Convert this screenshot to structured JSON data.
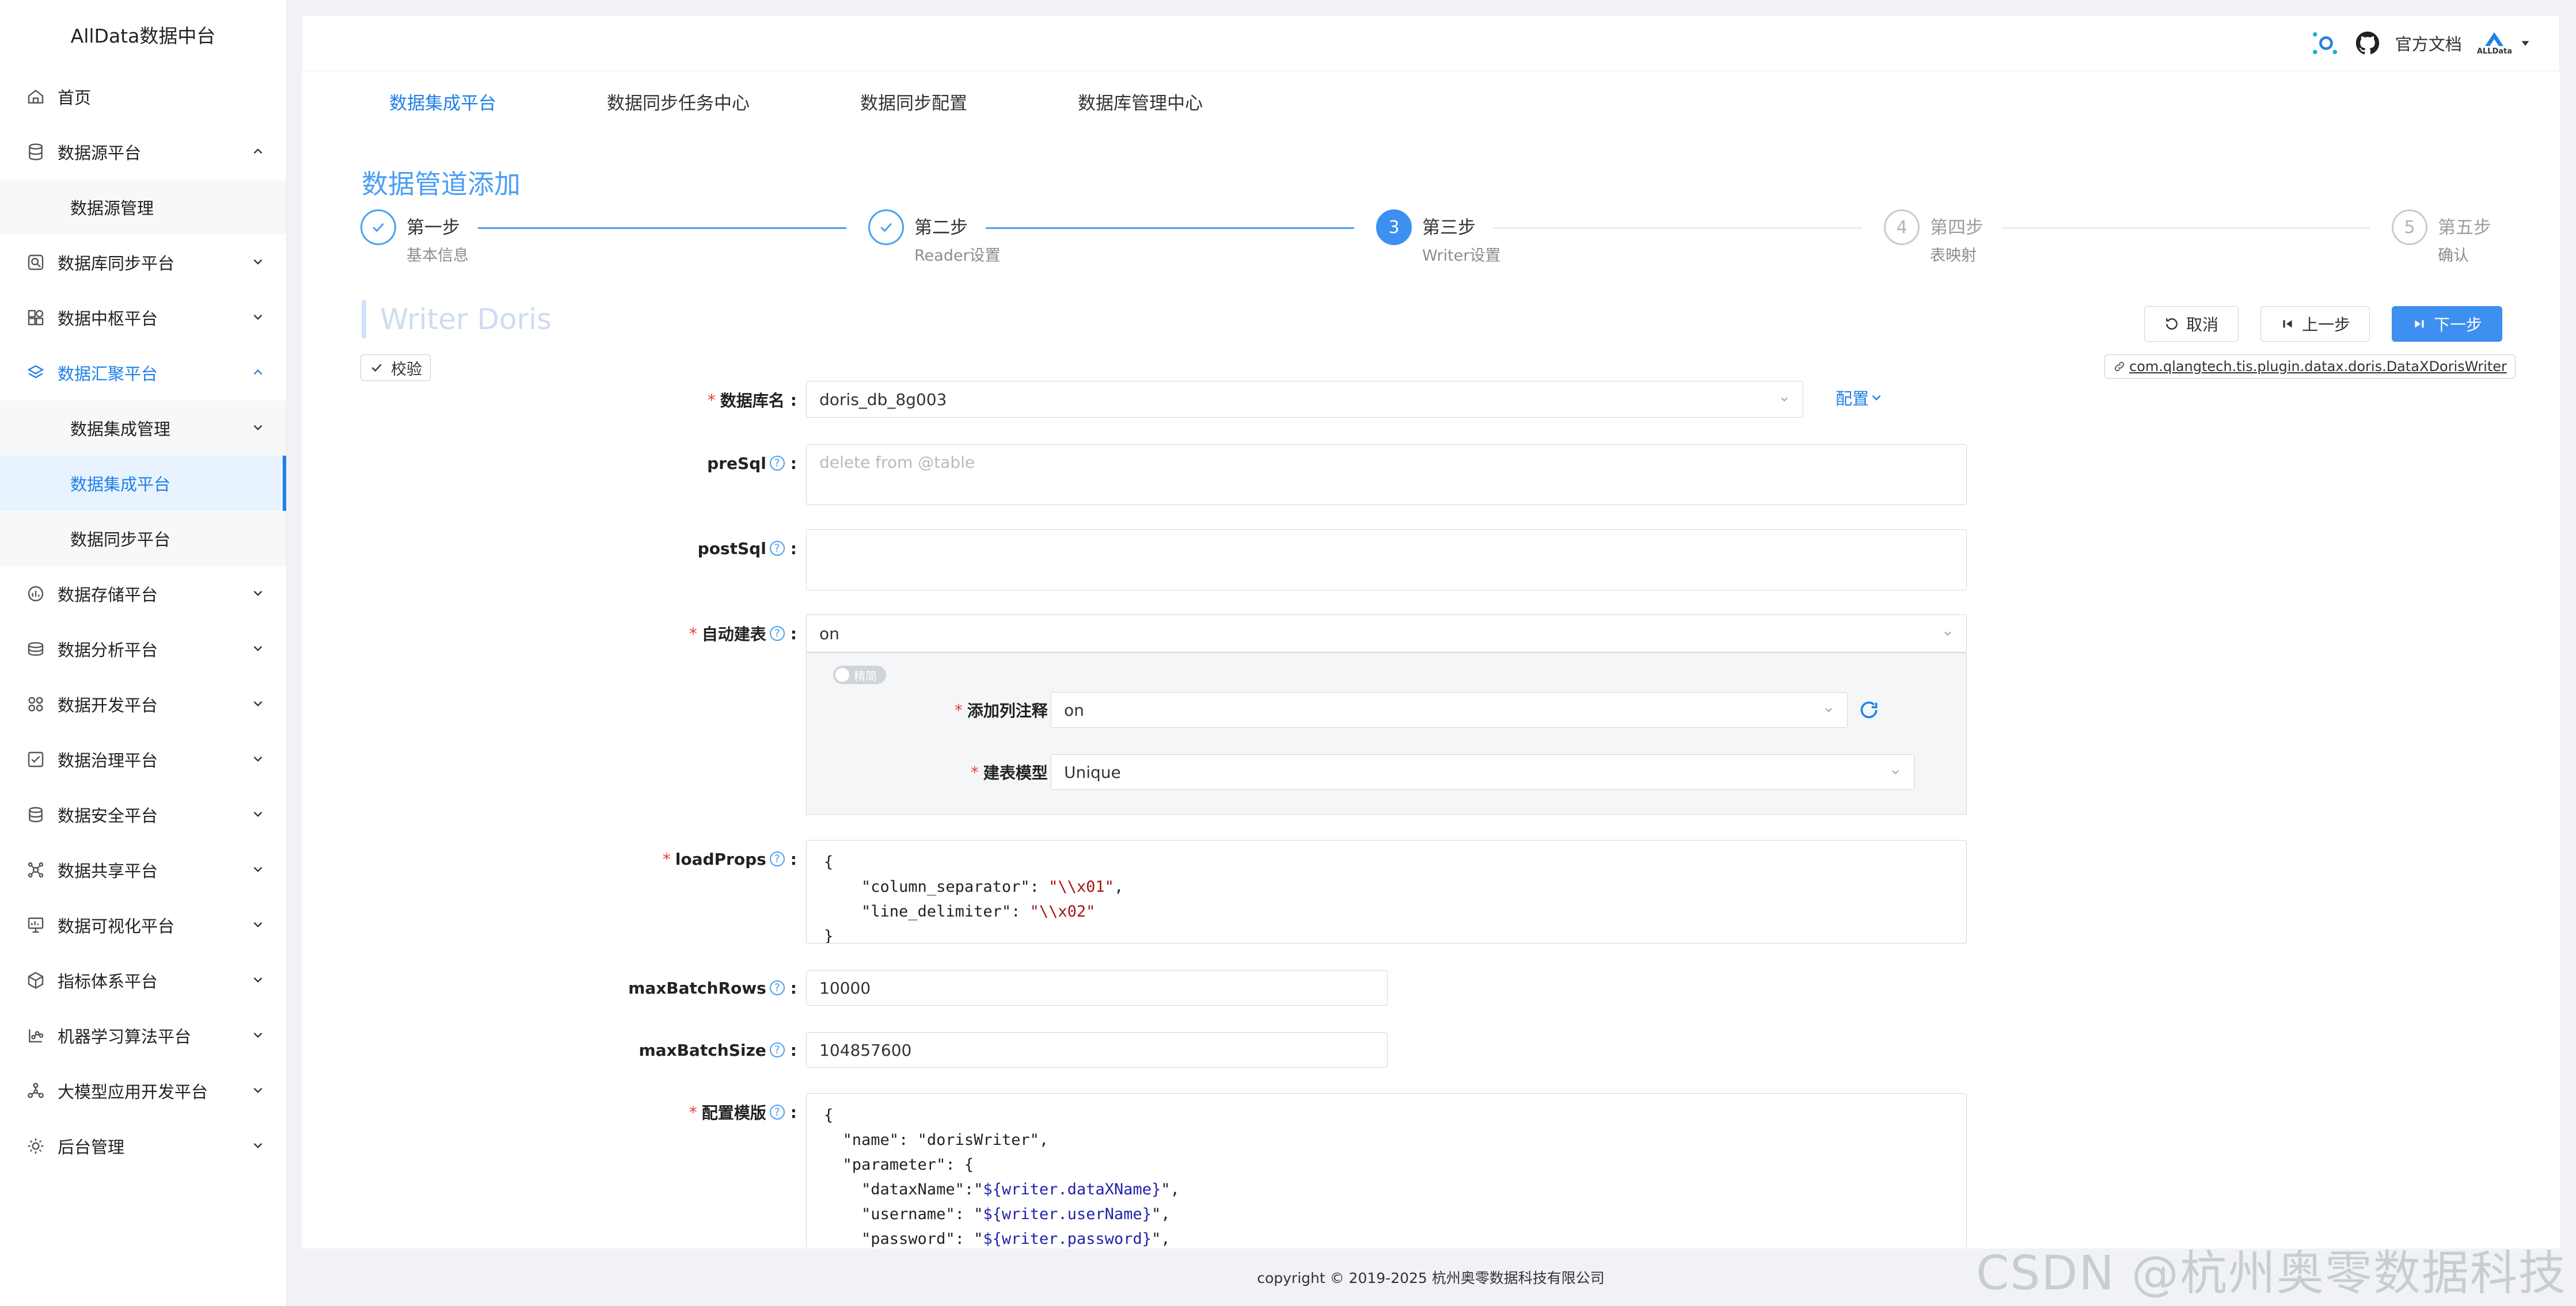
{
  "app": {
    "logo_text": "AllData数据中台"
  },
  "sidebar": {
    "items": [
      {
        "label": "首页",
        "icon": "home-icon"
      },
      {
        "label": "数据源平台",
        "icon": "database-icon",
        "expanded": true,
        "children": [
          {
            "label": "数据源管理"
          }
        ]
      },
      {
        "label": "数据库同步平台",
        "icon": "sync-icon"
      },
      {
        "label": "数据中枢平台",
        "icon": "grid-icon"
      },
      {
        "label": "数据汇聚平台",
        "icon": "layers-icon",
        "expanded": true,
        "active": true,
        "children": [
          {
            "label": "数据集成管理",
            "has_children": true
          },
          {
            "label": "数据集成平台",
            "selected": true
          },
          {
            "label": "数据同步平台"
          }
        ]
      },
      {
        "label": "数据存储平台",
        "icon": "storage-icon"
      },
      {
        "label": "数据分析平台",
        "icon": "analysis-icon"
      },
      {
        "label": "数据开发平台",
        "icon": "dev-icon"
      },
      {
        "label": "数据治理平台",
        "icon": "governance-icon"
      },
      {
        "label": "数据安全平台",
        "icon": "security-icon"
      },
      {
        "label": "数据共享平台",
        "icon": "share-icon"
      },
      {
        "label": "数据可视化平台",
        "icon": "monitor-icon"
      },
      {
        "label": "指标体系平台",
        "icon": "cube-icon"
      },
      {
        "label": "机器学习算法平台",
        "icon": "ml-icon"
      },
      {
        "label": "大模型应用开发平台",
        "icon": "llm-icon"
      },
      {
        "label": "后台管理",
        "icon": "admin-icon"
      }
    ]
  },
  "header": {
    "docs_label": "官方文档",
    "user_logo_text": "ALLData"
  },
  "tabs": [
    {
      "label": "数据集成平台",
      "active": true
    },
    {
      "label": "数据同步任务中心"
    },
    {
      "label": "数据同步配置"
    },
    {
      "label": "数据库管理中心"
    }
  ],
  "page_title": "数据管道添加",
  "steps": [
    {
      "title": "第一步",
      "desc": "基本信息",
      "status": "done"
    },
    {
      "title": "第二步",
      "desc": "Reader设置",
      "status": "done"
    },
    {
      "num": "3",
      "title": "第三步",
      "desc": "Writer设置",
      "status": "current"
    },
    {
      "num": "4",
      "title": "第四步",
      "desc": "表映射",
      "status": "wait"
    },
    {
      "num": "5",
      "title": "第五步",
      "desc": "确认",
      "status": "wait"
    }
  ],
  "writer_title": "Writer Doris",
  "buttons": {
    "cancel": "取消",
    "prev": "上一步",
    "next": "下一步",
    "verify": "校验"
  },
  "plugin_tag": "com.qlangtech.tis.plugin.datax.doris.DataXDorisWriter",
  "form": {
    "db_name": {
      "label": "数据库名",
      "value": "doris_db_8g003",
      "config_link": "配置"
    },
    "presql": {
      "label": "preSql",
      "placeholder": "delete from @table"
    },
    "postsql": {
      "label": "postSql",
      "value": ""
    },
    "auto_create": {
      "label": "自动建表",
      "value": "on",
      "toggle_text": "精简",
      "add_comment": {
        "label": "添加列注释",
        "value": "on"
      },
      "model": {
        "label": "建表模型",
        "value": "Unique"
      }
    },
    "load_props": {
      "label": "loadProps",
      "lines": [
        "{",
        "    \"column_separator\": ",
        "\"\\\\x01\"",
        ",",
        "    \"line_delimiter\": ",
        "\"\\\\x02\"",
        "}"
      ]
    },
    "max_batch_rows": {
      "label": "maxBatchRows",
      "value": "10000"
    },
    "max_batch_size": {
      "label": "maxBatchSize",
      "value": "104857600"
    },
    "template": {
      "label": "配置模版",
      "l1": "{",
      "l2k": "  \"name\": ",
      "l2v": "\"dorisWriter\"",
      "l2e": ",",
      "l3": "  \"parameter\": {",
      "l4k": "    \"dataxName\":\"",
      "l4v": "${writer.dataXName}",
      "l4e": "\",",
      "l5k": "    \"username\": \"",
      "l5v": "${writer.userName}",
      "l5e": "\",",
      "l6k": "    \"password\": \"",
      "l6v": "${writer.password}",
      "l6e": "\","
    }
  },
  "footer": "copyright © 2019-2025 杭州奥零数据科技有限公司",
  "watermark": "CSDN @杭州奥零数据科技",
  "colors": {
    "accent": "#1f80e8",
    "step_blue": "#3d8ff0",
    "required": "#e53e3e"
  }
}
